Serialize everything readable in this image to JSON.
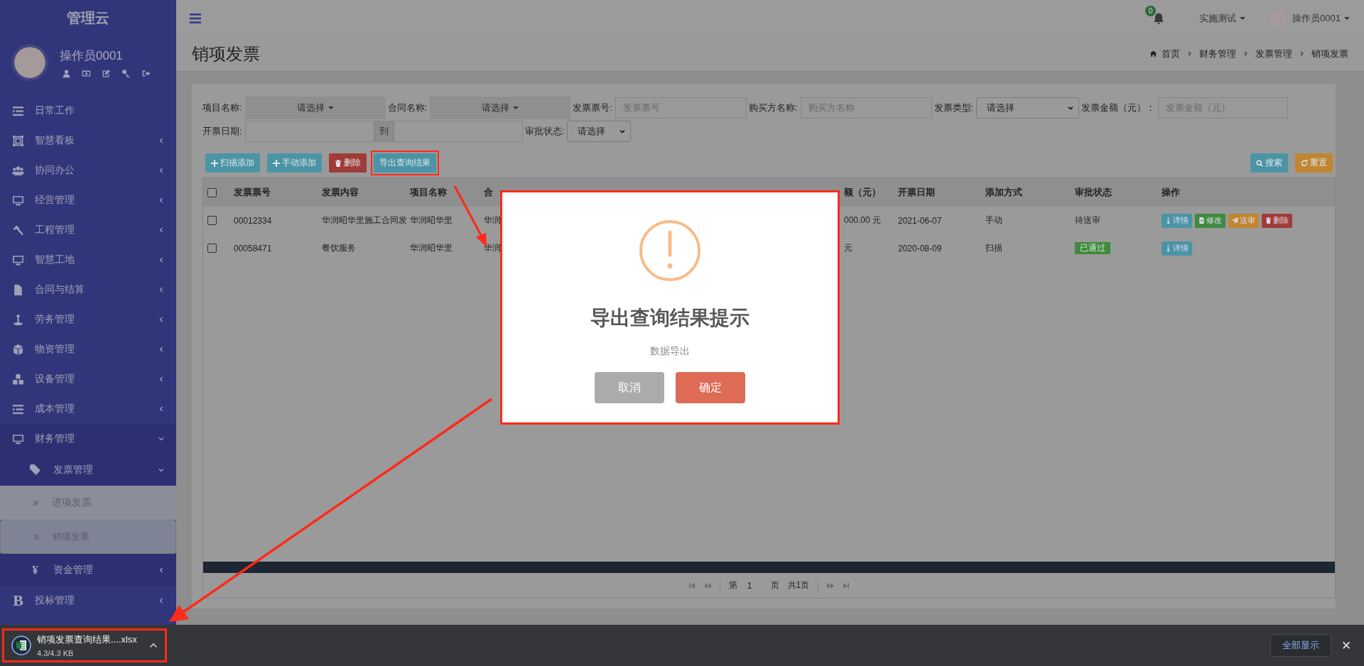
{
  "sidebar": {
    "logo": "管理云",
    "user": {
      "name": "操作员0001"
    },
    "menu": [
      {
        "label": "日常工作",
        "selected": false
      },
      {
        "label": "智慧看板",
        "expanded": false,
        "selected": false
      },
      {
        "label": "协同办公",
        "expanded": false,
        "selected": false
      },
      {
        "label": "经营管理",
        "expanded": false,
        "selected": false
      },
      {
        "label": "工程管理",
        "expanded": false,
        "selected": false
      },
      {
        "label": "智慧工地",
        "expanded": false,
        "selected": false
      },
      {
        "label": "合同与结算",
        "expanded": false,
        "selected": false
      },
      {
        "label": "劳务管理",
        "expanded": false,
        "selected": false
      },
      {
        "label": "物资管理",
        "expanded": false,
        "selected": false
      },
      {
        "label": "设备管理",
        "expanded": false,
        "selected": false
      },
      {
        "label": "成本管理",
        "expanded": false,
        "selected": false
      },
      {
        "label": "财务管理",
        "expanded": true,
        "selected": false,
        "children": [
          {
            "label": "发票管理",
            "expanded": true,
            "selected": false,
            "children": [
              {
                "label": "进项发票",
                "selected": false
              },
              {
                "label": "销项发票",
                "selected": true
              }
            ]
          },
          {
            "label": "资金管理",
            "icon": "¥",
            "expanded": false,
            "selected": false
          }
        ]
      },
      {
        "label": "投标管理",
        "icon": "B",
        "expanded": false,
        "selected": false
      }
    ]
  },
  "topbar": {
    "notifications": "0",
    "project": "实施测试",
    "user": "操作员0001"
  },
  "page": {
    "title": "销项发票",
    "breadcrumb": [
      "首页",
      "财务管理",
      "发票管理",
      "销项发票"
    ]
  },
  "filter_rows": [
    {
      "fields": [
        {
          "label": "项目名称:",
          "kind": "picker",
          "value": "请选择"
        },
        {
          "label": "合同名称:",
          "kind": "picker",
          "value": "请选择"
        },
        {
          "label": "发票票号:",
          "kind": "text",
          "placeholder": "发票票号"
        },
        {
          "label": "购买方名称:",
          "kind": "text",
          "placeholder": "购买方名称"
        },
        {
          "label": "发票类型:",
          "kind": "select",
          "value": "请选择"
        },
        {
          "label": "发票金额（元）：",
          "kind": "text",
          "placeholder": "发票金额（元）"
        }
      ]
    },
    {
      "fields": [
        {
          "label": "开票日期:",
          "kind": "range",
          "separator": "到"
        },
        {
          "label": "审批状态:",
          "kind": "select",
          "value": "请选择"
        }
      ]
    }
  ],
  "toolbar": {
    "left": [
      {
        "label": "扫描添加",
        "kind": "add",
        "highlighted": false
      },
      {
        "label": "手动添加",
        "kind": "add",
        "highlighted": false
      },
      {
        "label": "删除",
        "kind": "delete",
        "highlighted": false
      },
      {
        "label": "导出查询结果",
        "kind": "export",
        "highlighted": true
      }
    ],
    "right": [
      {
        "label": "搜索",
        "kind": "search",
        "highlighted": false
      },
      {
        "label": "重置",
        "kind": "reset",
        "highlighted": false
      }
    ]
  },
  "table": {
    "select_all": {
      "checked": false
    },
    "columns": [
      "发票票号",
      "发票内容",
      "项目名称",
      "合",
      "额（元）",
      "开票日期",
      "添加方式",
      "审批状态",
      "操作"
    ],
    "rows": [
      {
        "checked": false,
        "cells": [
          "00012334",
          "华润昭华里施工合同发",
          "华润昭华里",
          "华润",
          "000.00 元",
          "2021-06-07",
          "手动"
        ],
        "status": {
          "label": "待送审",
          "kind": "pending"
        },
        "actions": [
          {
            "label": "详情",
            "kind": "info"
          },
          {
            "label": "修改",
            "kind": "edit"
          },
          {
            "label": "送审",
            "kind": "submit"
          },
          {
            "label": "删除",
            "kind": "delete"
          }
        ]
      },
      {
        "checked": false,
        "cells": [
          "00058471",
          "餐饮服务",
          "华润昭华里",
          "华润",
          "元",
          "2020-08-09",
          "扫描"
        ],
        "status": {
          "label": "已通过",
          "kind": "approved"
        },
        "actions": [
          {
            "label": "详情",
            "kind": "info"
          }
        ]
      }
    ]
  },
  "pagination": {
    "prefix": "第",
    "page": "1",
    "suffix": "页",
    "total": "共1页"
  },
  "dialog": {
    "title": "导出查询结果提示",
    "message": "数据导出",
    "buttons": [
      {
        "label": "取消",
        "kind": "cancel"
      },
      {
        "label": "确定",
        "kind": "confirm"
      }
    ]
  },
  "download_bar": {
    "file": {
      "name": "销项发票查询结果....xlsx",
      "size": "4.3/4.3 KB",
      "highlighted": true
    },
    "show_all": "全部显示",
    "close": "✕"
  }
}
